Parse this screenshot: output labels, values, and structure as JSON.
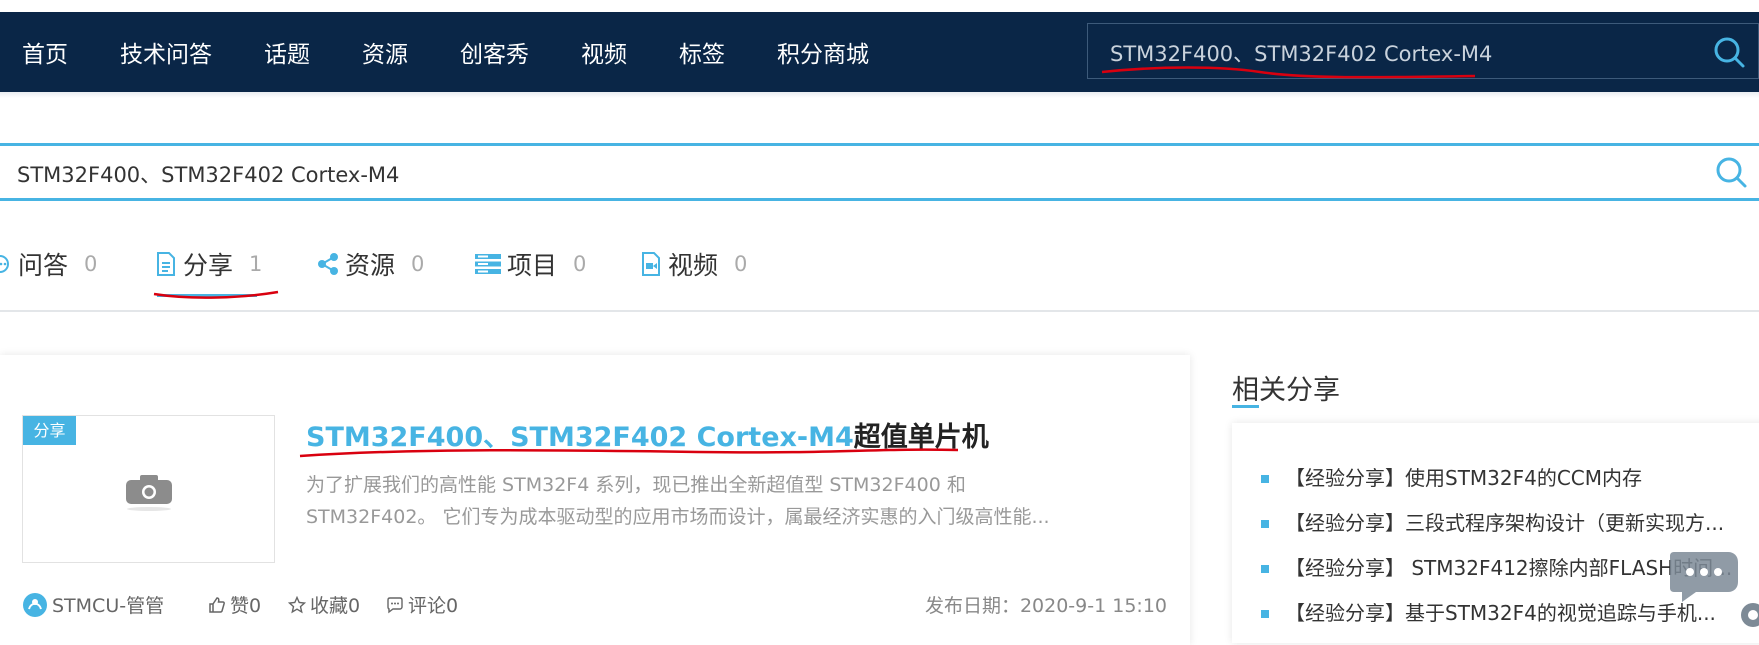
{
  "nav": {
    "items": [
      "首页",
      "技术问答",
      "话题",
      "资源",
      "创客秀",
      "视频",
      "标签",
      "积分商城"
    ],
    "search_value": "STM32F400、STM32F402 Cortex-M4"
  },
  "search": {
    "value": "STM32F400、STM32F402 Cortex-M4"
  },
  "tabs": [
    {
      "label": "问答",
      "count": "0"
    },
    {
      "label": "分享",
      "count": "1"
    },
    {
      "label": "资源",
      "count": "0"
    },
    {
      "label": "项目",
      "count": "0"
    },
    {
      "label": "视频",
      "count": "0"
    }
  ],
  "result": {
    "badge": "分享",
    "title_highlight": "STM32F400、STM32F402 Cortex-M4",
    "title_rest": "超值单片机",
    "desc_line1": "为了扩展我们的高性能 STM32F4 系列，现已推出全新超值型 STM32F400 和",
    "desc_line2": "STM32F402。 它们专为成本驱动型的应用市场而设计，属最经济实惠的入门级高性能...",
    "author": "STMCU-管管",
    "likes": "赞0",
    "favorites": "收藏0",
    "comments": "评论0",
    "date": "发布日期：2020-9-1 15:10"
  },
  "related": {
    "title": "相关分享",
    "items": [
      "【经验分享】使用STM32F4的CCM内存",
      "【经验分享】三段式程序架构设计（更新实现方...",
      "【经验分享】 STM32F412擦除内部FLASH时间...",
      "【经验分享】基于STM32F4的视觉追踪与手机..."
    ]
  },
  "colors": {
    "nav_bg": "#0a2647",
    "accent": "#47b4e3",
    "annotation": "#d9000f"
  },
  "icons": [
    "search-icon",
    "chat-icon",
    "document-icon",
    "share-icon",
    "list-icon",
    "video-icon",
    "camera-icon",
    "thumbs-up-icon",
    "star-icon",
    "comment-icon"
  ]
}
